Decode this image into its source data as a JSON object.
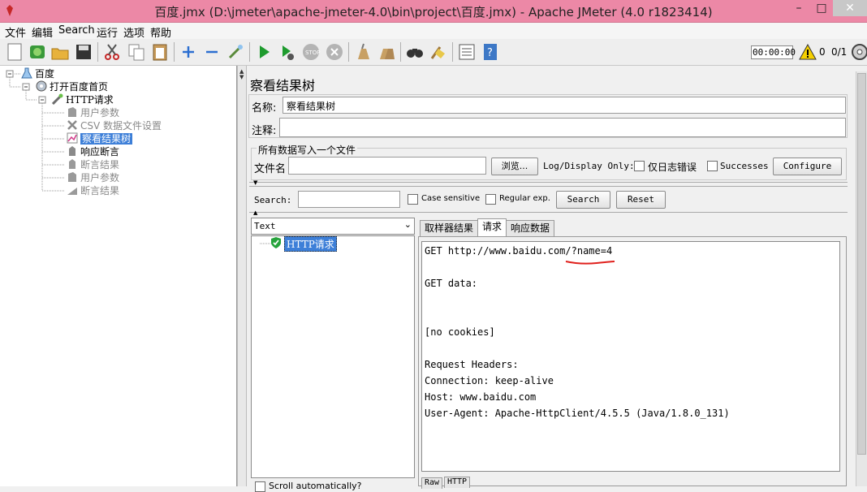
{
  "window": {
    "title": "百度.jmx (D:\\jmeter\\apache-jmeter-4.0\\bin\\project\\百度.jmx) - Apache JMeter (4.0 r1823414)",
    "minimize": "–",
    "maximize": "□",
    "close": "✕"
  },
  "menu": [
    "文件",
    "编辑",
    "Search",
    "运行",
    "选项",
    "帮助"
  ],
  "toolbar": {
    "timer": "00:00:00",
    "warning_count": "0",
    "threads": "0/1"
  },
  "tree": {
    "root": "百度",
    "thread_group": "打开百度首页",
    "sampler": "HTTP请求",
    "children": [
      "用户参数",
      "CSV 数据文件设置",
      "察看结果树",
      "响应断言",
      "断言结果",
      "用户参数",
      "断言结果"
    ]
  },
  "panel": {
    "title": "察看结果树",
    "name_label": "名称:",
    "name_value": "察看结果树",
    "comment_label": "注释:",
    "comment_value": "",
    "file_section_title": "所有数据写入一个文件",
    "filename_label": "文件名",
    "filename_value": "",
    "browse_button": "浏览...",
    "log_display_label": "Log/Display Only:",
    "errors_only_label": "仅日志错误",
    "successes_label": "Successes",
    "configure_button": "Configure"
  },
  "search": {
    "label": "Search:",
    "value": "",
    "case_sensitive": "Case sensitive",
    "regular_exp": "Regular exp.",
    "search_button": "Search",
    "reset_button": "Reset"
  },
  "results": {
    "renderer": "Text",
    "items": [
      "HTTP请求"
    ],
    "scroll_checkbox_label": "Scroll automatically?"
  },
  "tabs": [
    "取样器结果",
    "请求",
    "响应数据"
  ],
  "active_tab": "请求",
  "request_text": [
    "GET http://www.baidu.com/?name=4",
    "",
    "GET data:",
    "",
    "",
    "[no cookies]",
    "",
    "Request Headers:",
    "Connection: keep-alive",
    "Host: www.baidu.com",
    "User-Agent: Apache-HttpClient/4.5.5 (Java/1.8.0_131)"
  ],
  "bottom_tabs": [
    "Raw",
    "HTTP"
  ],
  "colors": {
    "titlebar": "#ec88a6",
    "selection": "#3d7fd8",
    "annotation_underline": "#e0201c"
  }
}
